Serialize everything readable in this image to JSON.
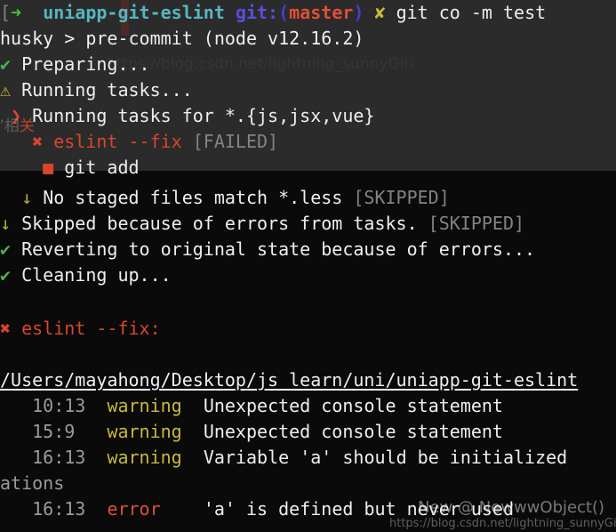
{
  "terminal": {
    "background_upper": "#2b2b2b",
    "background_lower": "#0a0a0a",
    "foreground": "#eceff1",
    "prompt": {
      "bracket": "[",
      "arrow_icon": "➜",
      "cwd": "uniapp-git-eslint",
      "git_label": "git:",
      "paren_open": "(",
      "branch": "master",
      "paren_close": ")",
      "dirty_icon": "✘",
      "command": "git co -m test"
    },
    "lines": {
      "husky": "husky > pre-commit (node v12.16.2)",
      "preparing_icon": "✔",
      "preparing": "Preparing...",
      "running_tasks_icon": "⚠",
      "running_tasks": "Running tasks...",
      "running_for_icon": "❯",
      "running_for": "Running tasks for *.{js,jsx,vue}",
      "eslint_fix_icon": "✖",
      "eslint_fix": "eslint --fix",
      "eslint_fix_status": "[FAILED]",
      "git_add_icon": "■",
      "git_add": "git add",
      "no_staged_icon": "↓",
      "no_staged": "No staged files match *.less",
      "no_staged_status": "[SKIPPED]",
      "skipped_icon": "↓",
      "skipped": "Skipped because of errors from tasks.",
      "skipped_status": "[SKIPPED]",
      "reverting_icon": "✔",
      "reverting": "Reverting to original state because of errors...",
      "cleaning_icon": "✔",
      "cleaning": "Cleaning up...",
      "eslint_header_icon": "✖",
      "eslint_header": "eslint --fix:",
      "file_path": "/Users/mayahong/Desktop/js_learn/uni/uniapp-git-eslint"
    },
    "problems": [
      {
        "location": "10:13",
        "severity": "warning",
        "message": "Unexpected console statement"
      },
      {
        "location": "15:9",
        "severity": "warning",
        "message": "Unexpected console statement"
      },
      {
        "location": "16:13",
        "severity": "warning",
        "message": "Variable 'a' should be initialized",
        "wrap": "ations"
      },
      {
        "location": "16:13",
        "severity": "error",
        "message": "'a' is defined but never used"
      }
    ],
    "watermark": {
      "chinese_prefix": "”相",
      "chinese_accent": "关",
      "top_faint": "https://blog.csdn.net/lightning_sunnyGirl",
      "name": "New @ NewwwObject()",
      "url": "https://blog.csdn.net/lightning_sunnyGirl"
    },
    "colors": {
      "green": "#4caf50",
      "red": "#d9452f",
      "yellow": "#c8b93c",
      "gray": "#838383",
      "cyan": "#56b6c2",
      "purple": "#5b4ee0",
      "blue": "#4040d0"
    }
  }
}
